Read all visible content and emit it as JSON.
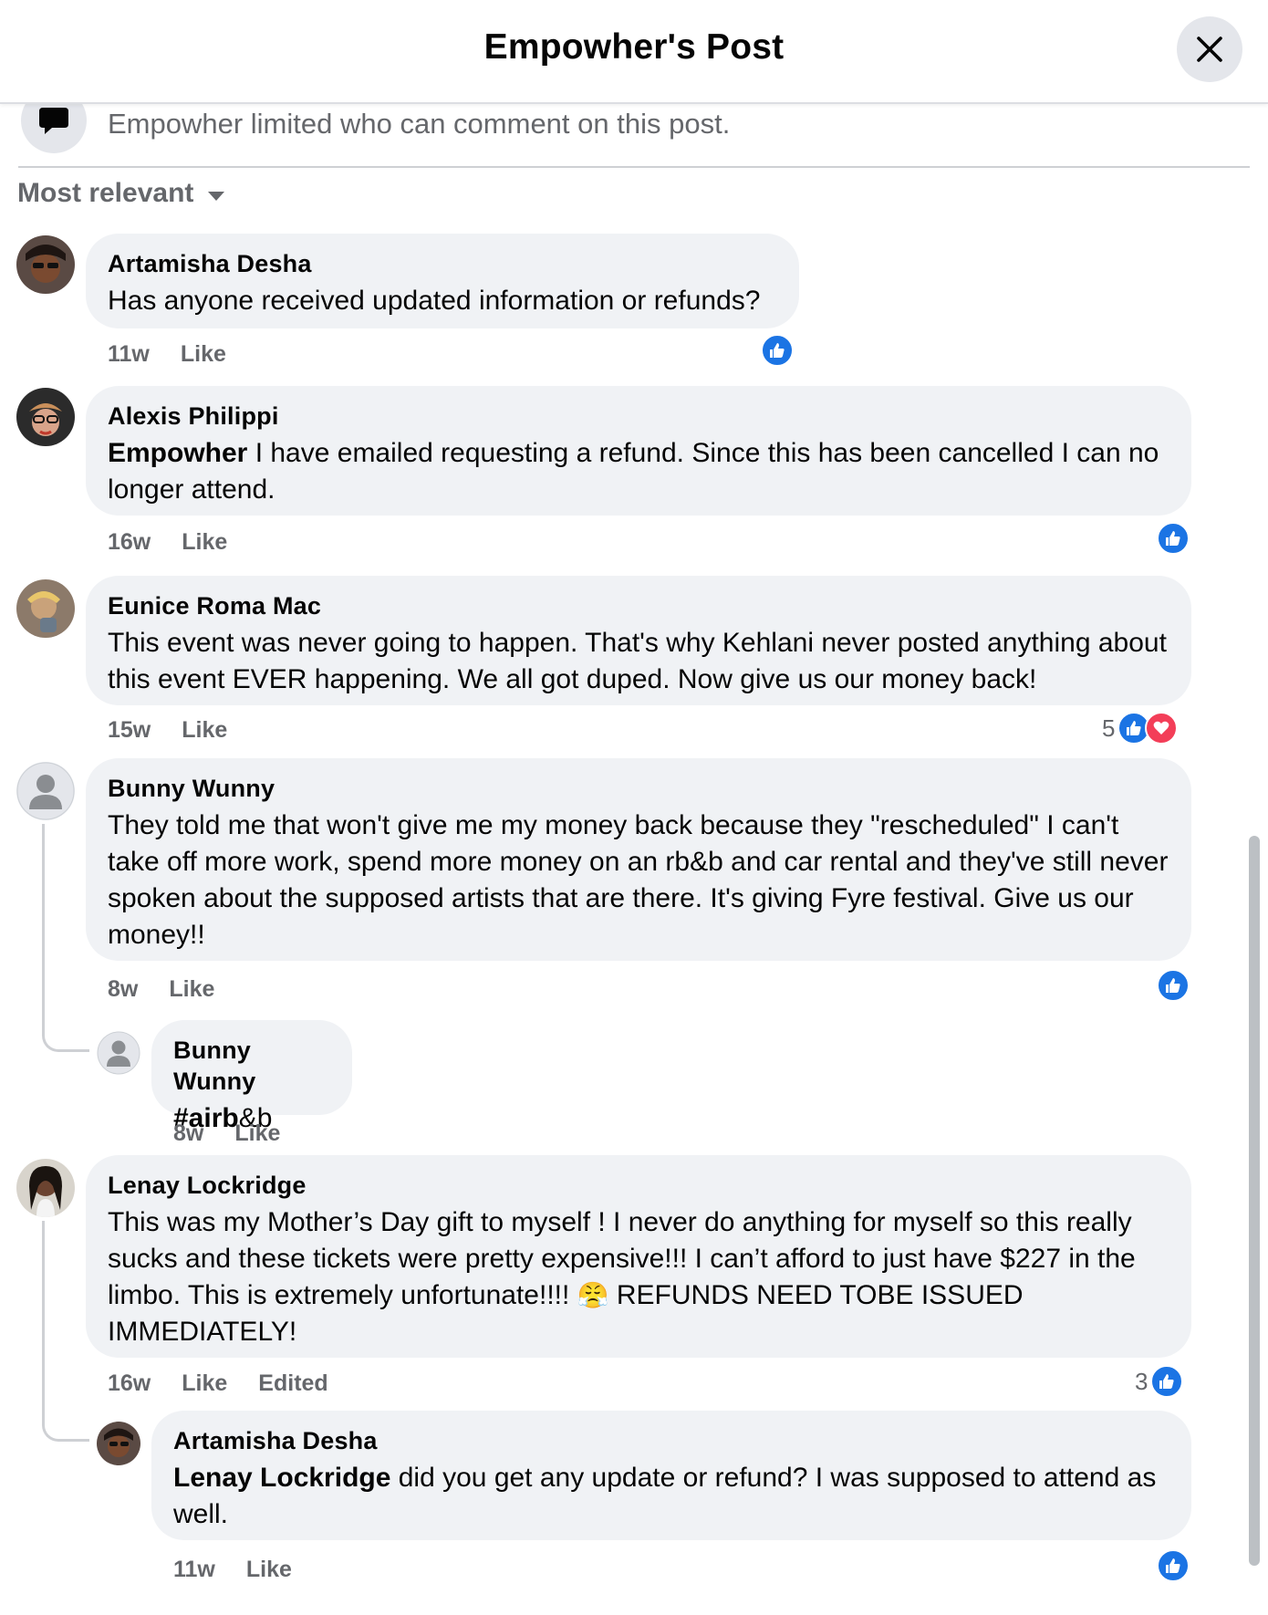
{
  "header": {
    "title": "Empowher's Post",
    "close_icon": "close-icon"
  },
  "notice": {
    "icon": "comment-bubble-icon",
    "text": "Empowher limited who can comment on this post."
  },
  "sort": {
    "label": "Most relevant",
    "icon": "caret-down-icon"
  },
  "comments": [
    {
      "author": "Artamisha Desha",
      "text": "Has anyone received updated information or refunds?",
      "time": "11w",
      "like": "Like",
      "reactions": {
        "count": "",
        "types": [
          "like"
        ]
      }
    },
    {
      "author": "Alexis Philippi",
      "mention": "Empowher",
      "text": " I have emailed requesting a refund. Since this has been cancelled I can no longer attend.",
      "time": "16w",
      "like": "Like",
      "reactions": {
        "count": "",
        "types": [
          "like"
        ]
      }
    },
    {
      "author": "Eunice Roma Mac",
      "text": "This event was never going to happen. That's why Kehlani never posted anything about this event EVER happening. We all got duped. Now give us our money back!",
      "time": "15w",
      "like": "Like",
      "reactions": {
        "count": "5",
        "types": [
          "like",
          "love"
        ]
      }
    },
    {
      "author": "Bunny Wunny",
      "text": "They told me that won't give me my money back because they \"rescheduled\" I can't take off more work, spend more money on an rb&b and car rental and they've still never spoken about the supposed artists that are there. It's giving Fyre festival. Give us our money!!",
      "time": "8w",
      "like": "Like",
      "reactions": {
        "count": "",
        "types": [
          "like"
        ]
      },
      "reply": {
        "author": "Bunny Wunny",
        "hashtag": "#airb",
        "text": "&b",
        "time": "8w",
        "like": "Like"
      }
    },
    {
      "author": "Lenay Lockridge",
      "text_before_emoji": "This was my Mother’s Day gift to myself ! I never do anything for myself so this really sucks and these tickets were pretty expensive!!! I can’t afford to just have $227 in the limbo. This is extremely unfortunate!!!! ",
      "emoji": "😤",
      "text_after_emoji": " REFUNDS NEED TOBE ISSUED IMMEDIATELY!",
      "time": "16w",
      "like": "Like",
      "edited": "Edited",
      "reactions": {
        "count": "3",
        "types": [
          "like"
        ]
      },
      "reply": {
        "author": "Artamisha Desha",
        "mention": "Lenay Lockridge",
        "text": " did you get any update or refund? I was supposed to attend as well.",
        "time": "11w",
        "like": "Like",
        "reactions": {
          "count": "",
          "types": [
            "like"
          ]
        }
      }
    }
  ],
  "colors": {
    "like_blue": "#1b74e4",
    "love_red": "#f33e58",
    "bubble_bg": "#f0f2f5",
    "meta_gray": "#65676b"
  }
}
